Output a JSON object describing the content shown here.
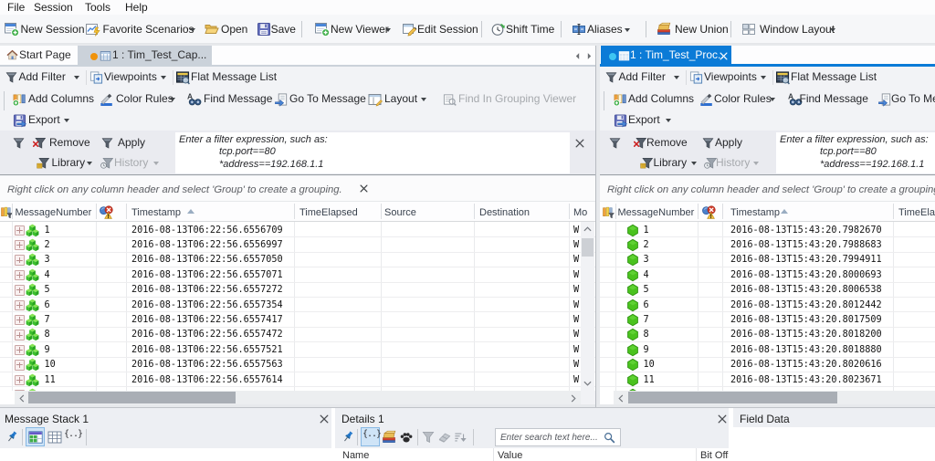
{
  "menubar": {
    "items": [
      "File",
      "Session",
      "Tools",
      "Help"
    ]
  },
  "toolbar": {
    "new_session": "New Session",
    "favorite_scenarios": "Favorite Scenarios",
    "open": "Open",
    "save": "Save",
    "new_viewer": "New Viewer",
    "edit_session": "Edit Session",
    "shift_time": "Shift Time",
    "aliases": "Aliases",
    "new_union": "New Union",
    "window_layout": "Window Layout"
  },
  "panes": {
    "left": {
      "tabs": {
        "start_page": "Start Page",
        "document": "1 : Tim_Test_Cap..."
      },
      "viewer_toolbar": {
        "add_filter": "Add Filter",
        "viewpoints": "Viewpoints",
        "flat_message_list": "Flat Message List"
      },
      "grid_toolbar": {
        "add_columns": "Add Columns",
        "color_rules": "Color Rules",
        "find_message": "Find Message",
        "go_to_message": "Go To Message",
        "layout": "Layout",
        "find_in_grouping_viewer": "Find In Grouping Viewer",
        "export": "Export"
      },
      "filter_panel": {
        "remove": "Remove",
        "apply": "Apply",
        "library": "Library",
        "history": "History",
        "placeholder": [
          "Enter a filter expression, such as:",
          "tcp.port==80",
          "*address==192.168.1.1"
        ]
      },
      "grouping_hint": "Right click on any column header and select 'Group' to create a grouping.",
      "columns": {
        "message_number": "MessageNumber",
        "timestamp": "Timestamp",
        "time_elapsed": "TimeElapsed",
        "source": "Source",
        "destination": "Destination",
        "module": "Mo"
      },
      "rows": [
        {
          "number": "1",
          "timestamp": "2016-08-13T06:22:56.6556709",
          "module": "W"
        },
        {
          "number": "2",
          "timestamp": "2016-08-13T06:22:56.6556997",
          "module": "W"
        },
        {
          "number": "3",
          "timestamp": "2016-08-13T06:22:56.6557050",
          "module": "W"
        },
        {
          "number": "4",
          "timestamp": "2016-08-13T06:22:56.6557071",
          "module": "W"
        },
        {
          "number": "5",
          "timestamp": "2016-08-13T06:22:56.6557272",
          "module": "W"
        },
        {
          "number": "6",
          "timestamp": "2016-08-13T06:22:56.6557354",
          "module": "W"
        },
        {
          "number": "7",
          "timestamp": "2016-08-13T06:22:56.6557417",
          "module": "W"
        },
        {
          "number": "8",
          "timestamp": "2016-08-13T06:22:56.6557472",
          "module": "W"
        },
        {
          "number": "9",
          "timestamp": "2016-08-13T06:22:56.6557521",
          "module": "W"
        },
        {
          "number": "10",
          "timestamp": "2016-08-13T06:22:56.6557563",
          "module": "W"
        },
        {
          "number": "11",
          "timestamp": "2016-08-13T06:22:56.6557614",
          "module": "W"
        }
      ]
    },
    "right": {
      "tabs": {
        "document": "1 : Tim_Test_Proc..."
      },
      "viewer_toolbar": {
        "add_filter": "Add Filter",
        "viewpoints": "Viewpoints",
        "flat_message_list": "Flat Message List"
      },
      "grid_toolbar": {
        "add_columns": "Add Columns",
        "color_rules": "Color Rules",
        "find_message": "Find Message",
        "go_to_message": "Go To Message",
        "export": "Export"
      },
      "filter_panel": {
        "remove": "Remove",
        "apply": "Apply",
        "library": "Library",
        "history": "History",
        "placeholder": [
          "Enter a filter expression, such as:",
          "tcp.port==80",
          "*address==192.168.1.1"
        ]
      },
      "grouping_hint": "Right click on any column header and select 'Group' to create a grouping.",
      "columns": {
        "message_number": "MessageNumber",
        "timestamp": "Timestamp",
        "time_elapsed": "TimeElapsed"
      },
      "rows": [
        {
          "number": "1",
          "timestamp": "2016-08-13T15:43:20.7982670"
        },
        {
          "number": "2",
          "timestamp": "2016-08-13T15:43:20.7988683"
        },
        {
          "number": "3",
          "timestamp": "2016-08-13T15:43:20.7994911"
        },
        {
          "number": "4",
          "timestamp": "2016-08-13T15:43:20.8000693"
        },
        {
          "number": "5",
          "timestamp": "2016-08-13T15:43:20.8006538"
        },
        {
          "number": "6",
          "timestamp": "2016-08-13T15:43:20.8012442"
        },
        {
          "number": "7",
          "timestamp": "2016-08-13T15:43:20.8017509"
        },
        {
          "number": "8",
          "timestamp": "2016-08-13T15:43:20.8018200"
        },
        {
          "number": "9",
          "timestamp": "2016-08-13T15:43:20.8018880"
        },
        {
          "number": "10",
          "timestamp": "2016-08-13T15:43:20.8020616"
        },
        {
          "number": "11",
          "timestamp": "2016-08-13T15:43:20.8023671"
        }
      ]
    }
  },
  "bottom_panels": {
    "message_stack": {
      "title": "Message Stack 1"
    },
    "details": {
      "title": "Details 1",
      "search_placeholder": "Enter search text here...",
      "columns": {
        "name": "Name",
        "value": "Value",
        "bit_offset": "Bit Offs"
      }
    },
    "field_data": {
      "title": "Field Data"
    }
  },
  "colors": {
    "accent_blue": "#0b7bd7",
    "modified_dot_orange": "#f0920a",
    "running_dot_cyan": "#3ec6f2",
    "row_icon_green": "#49c21d"
  }
}
